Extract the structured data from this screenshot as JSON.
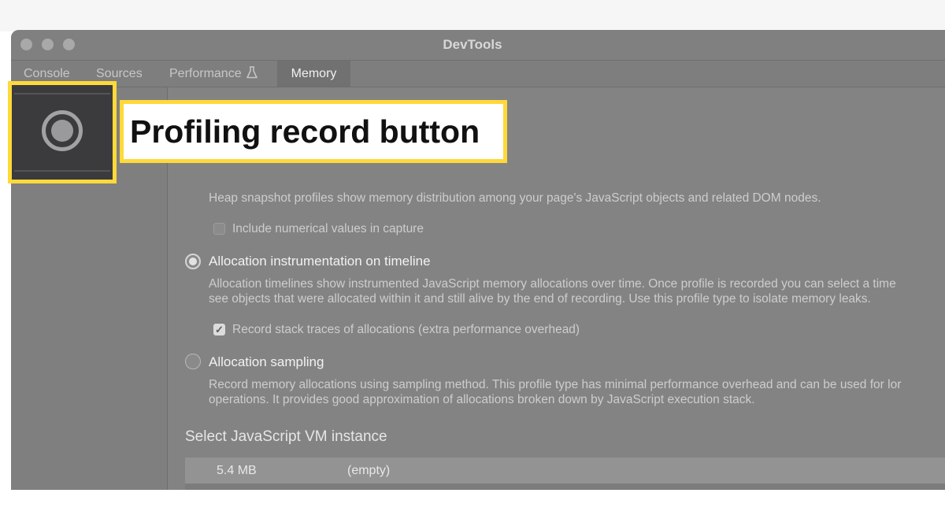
{
  "window": {
    "title": "DevTools"
  },
  "tabs": [
    {
      "label": "Console"
    },
    {
      "label": "Sources"
    },
    {
      "label": "Performance"
    },
    {
      "label": "Memory"
    }
  ],
  "profiles": {
    "heap_snapshot_desc": "Heap snapshot profiles show memory distribution among your page's JavaScript objects and related DOM nodes.",
    "include_numerical_label": "Include numerical values in capture",
    "include_numerical_checked": false,
    "allocation_timeline": {
      "label": "Allocation instrumentation on timeline",
      "selected": true,
      "desc_line1": "Allocation timelines show instrumented JavaScript memory allocations over time. Once profile is recorded you can select a time",
      "desc_line2": "see objects that were allocated within it and still alive by the end of recording. Use this profile type to isolate memory leaks.",
      "stack_traces_label": "Record stack traces of allocations (extra performance overhead)",
      "stack_traces_checked": true
    },
    "allocation_sampling": {
      "label": "Allocation sampling",
      "selected": false,
      "desc_line1": "Record memory allocations using sampling method. This profile type has minimal performance overhead and can be used for lor",
      "desc_line2": "operations. It provides good approximation of allocations broken down by JavaScript execution stack."
    }
  },
  "vm": {
    "heading": "Select JavaScript VM instance",
    "rows": [
      {
        "size": "5.4 MB",
        "name": "(empty)"
      }
    ]
  },
  "annotation": {
    "label": "Profiling record button",
    "highlight_color": "#ffd93a"
  },
  "icons": {
    "record": "record-icon",
    "flask": "flask-icon"
  }
}
